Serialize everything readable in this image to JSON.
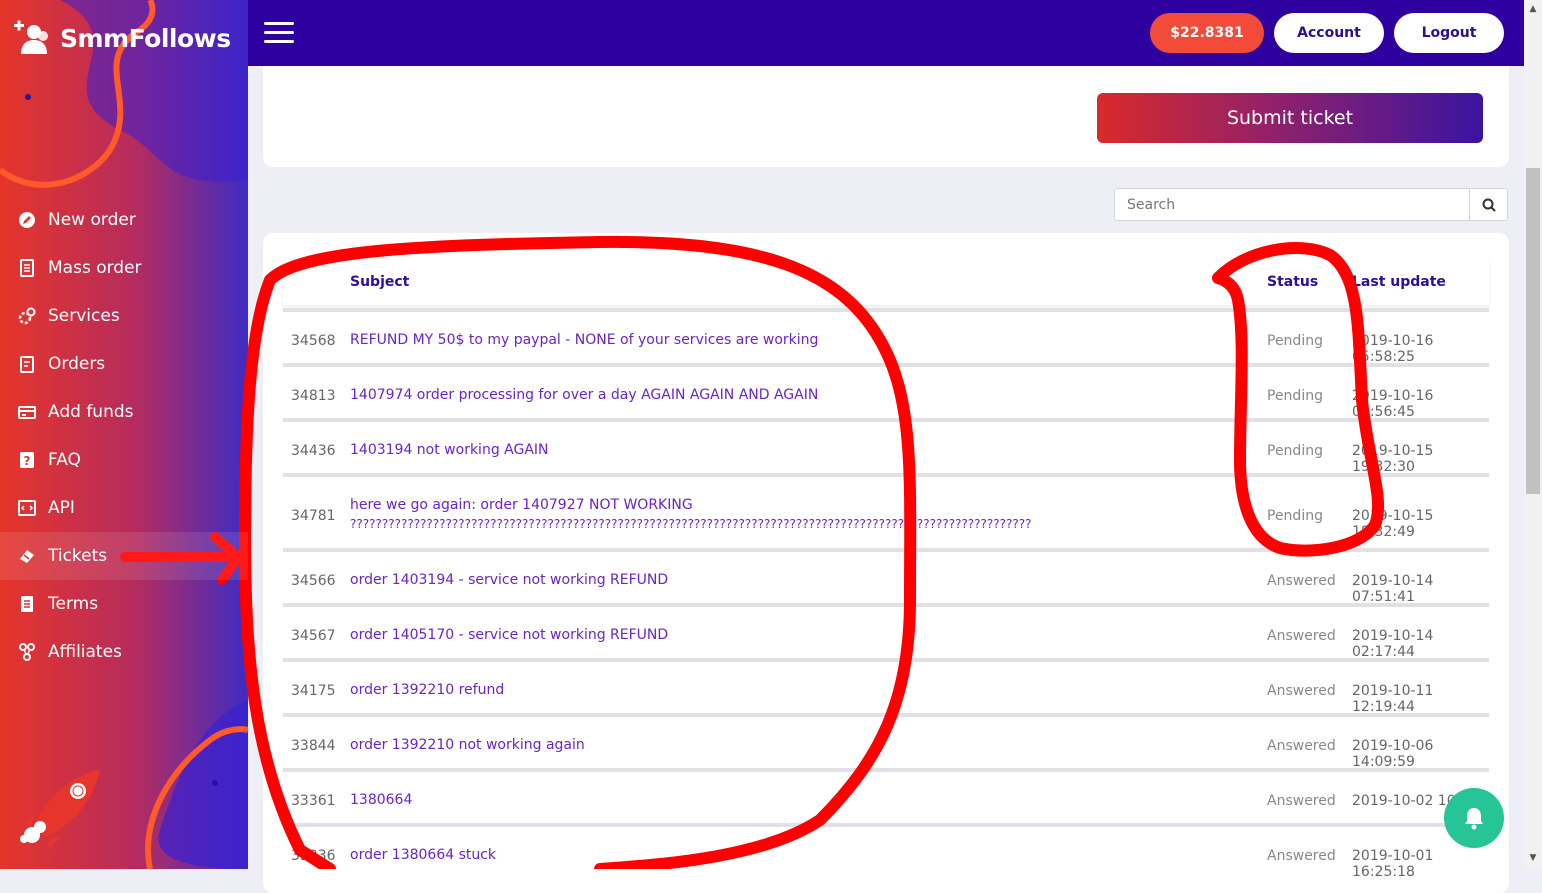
{
  "brand": {
    "name": "SmmFollows"
  },
  "header": {
    "balance": "$22.8381",
    "account_label": "Account",
    "logout_label": "Logout"
  },
  "sidebar": {
    "items": [
      {
        "label": "New order",
        "icon": "pencil-icon"
      },
      {
        "label": "Mass order",
        "icon": "list-icon"
      },
      {
        "label": "Services",
        "icon": "gears-icon"
      },
      {
        "label": "Orders",
        "icon": "clipboard-icon"
      },
      {
        "label": "Add funds",
        "icon": "money-icon"
      },
      {
        "label": "FAQ",
        "icon": "question-icon"
      },
      {
        "label": "API",
        "icon": "code-icon"
      },
      {
        "label": "Tickets",
        "icon": "ticket-icon"
      },
      {
        "label": "Terms",
        "icon": "document-icon"
      },
      {
        "label": "Affiliates",
        "icon": "affiliates-icon"
      }
    ],
    "active": "Tickets"
  },
  "submit": {
    "label": "Submit ticket"
  },
  "search": {
    "placeholder": "Search"
  },
  "table": {
    "headers": {
      "id": "",
      "subject": "Subject",
      "status": "Status",
      "last_update": "Last update"
    },
    "rows": [
      {
        "id": "34568",
        "subject": "REFUND MY 50$ to my paypal - NONE of your services are working",
        "status": "Pending",
        "updated": "2019-10-16 05:58:25"
      },
      {
        "id": "34813",
        "subject": "1407974 order processing for over a day AGAIN AGAIN AND AGAIN",
        "status": "Pending",
        "updated": "2019-10-16 05:56:45"
      },
      {
        "id": "34436",
        "subject": "1403194 not working AGAIN",
        "status": "Pending",
        "updated": "2019-10-15 19:32:30"
      },
      {
        "id": "34781",
        "subject": "here we go again: order 1407927 NOT WORKING",
        "subject_line2": "???????????????????????????????????????????????????????????????????????????????????????????????????????????",
        "status": "Pending",
        "updated": "2019-10-15 18:32:49"
      },
      {
        "id": "34566",
        "subject": "order 1403194 - service not working REFUND",
        "status": "Answered",
        "updated": "2019-10-14 07:51:41"
      },
      {
        "id": "34567",
        "subject": "order 1405170 - service not working REFUND",
        "status": "Answered",
        "updated": "2019-10-14 02:17:44"
      },
      {
        "id": "34175",
        "subject": "order 1392210 refund",
        "status": "Answered",
        "updated": "2019-10-11 12:19:44"
      },
      {
        "id": "33844",
        "subject": "order 1392210 not working again",
        "status": "Answered",
        "updated": "2019-10-06 14:09:59"
      },
      {
        "id": "33361",
        "subject": "1380664",
        "status": "Answered",
        "updated": "2019-10-02 10:22"
      },
      {
        "id": "33336",
        "subject": "order 1380664 stuck",
        "status": "Answered",
        "updated": "2019-10-01 16:25:18"
      }
    ]
  },
  "colors": {
    "topbar": "#2e00a0",
    "accent_red": "#f24b3a",
    "link_purple": "#6a24c8",
    "annotation_red": "#ff0000",
    "bell_green": "#27c498"
  }
}
